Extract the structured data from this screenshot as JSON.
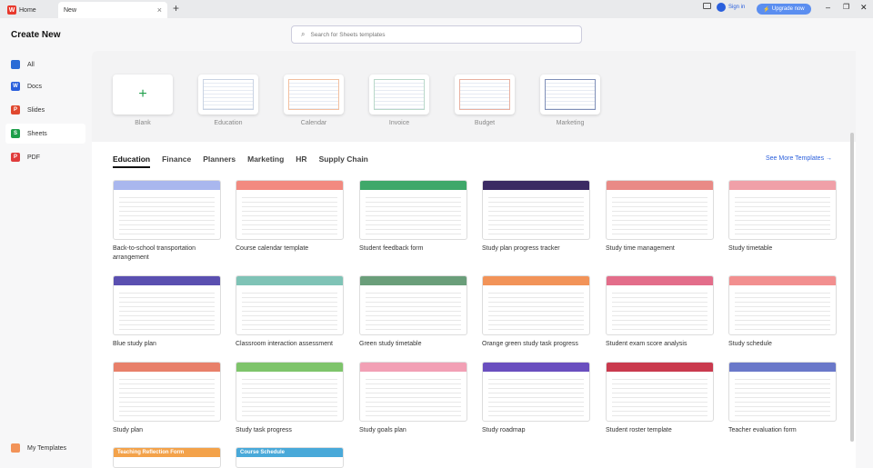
{
  "tabs": {
    "home": "Home",
    "new": "New"
  },
  "topright": {
    "signin": "Sign in",
    "upgrade": "Upgrade now"
  },
  "sidebar": {
    "title": "Create New",
    "items": [
      {
        "label": "All",
        "color": "#2a6bd6"
      },
      {
        "label": "Docs",
        "color": "#2a5fdc"
      },
      {
        "label": "Slides",
        "color": "#e0482f"
      },
      {
        "label": "Sheets",
        "color": "#1e9e4a"
      },
      {
        "label": "PDF",
        "color": "#e03c3c"
      }
    ],
    "bottom": "My Templates"
  },
  "search": {
    "placeholder": "Search for Sheets templates"
  },
  "hero": [
    "Blank",
    "Education",
    "Calendar",
    "Invoice",
    "Budget",
    "Marketing"
  ],
  "categories": [
    "Education",
    "Finance",
    "Planners",
    "Marketing",
    "HR",
    "Supply Chain"
  ],
  "see_more": "See More Templates",
  "templates": [
    {
      "name": "Back-to-school transportation arrangement",
      "color": "#a9b7ee"
    },
    {
      "name": "Course calendar template",
      "color": "#f28a80"
    },
    {
      "name": "Student feedback form",
      "color": "#3fa86a"
    },
    {
      "name": "Study plan progress tracker",
      "color": "#3b2a63"
    },
    {
      "name": "Study time management",
      "color": "#e98a86"
    },
    {
      "name": "Study timetable",
      "color": "#f0a0a8"
    },
    {
      "name": "Blue study plan",
      "color": "#5a4fb0"
    },
    {
      "name": "Classroom interaction assessment",
      "color": "#7fc3b6"
    },
    {
      "name": "Green study timetable",
      "color": "#6a9e7a"
    },
    {
      "name": "Orange green study task progress",
      "color": "#f29358"
    },
    {
      "name": "Student exam score analysis",
      "color": "#e36d8a"
    },
    {
      "name": "Study schedule",
      "color": "#f28f8f"
    },
    {
      "name": "Study plan",
      "color": "#e8806a"
    },
    {
      "name": "Study task progress",
      "color": "#7ec46b"
    },
    {
      "name": "Study goals plan",
      "color": "#f2a0b5"
    },
    {
      "name": "Study roadmap",
      "color": "#6a4fbf"
    },
    {
      "name": "Student roster template",
      "color": "#c93a4e"
    },
    {
      "name": "Teacher evaluation form",
      "color": "#6a78c9"
    },
    {
      "name": "Teaching Reflection Form",
      "color": "#f3a24a"
    },
    {
      "name": "Course Schedule",
      "color": "#49a9d9"
    }
  ]
}
